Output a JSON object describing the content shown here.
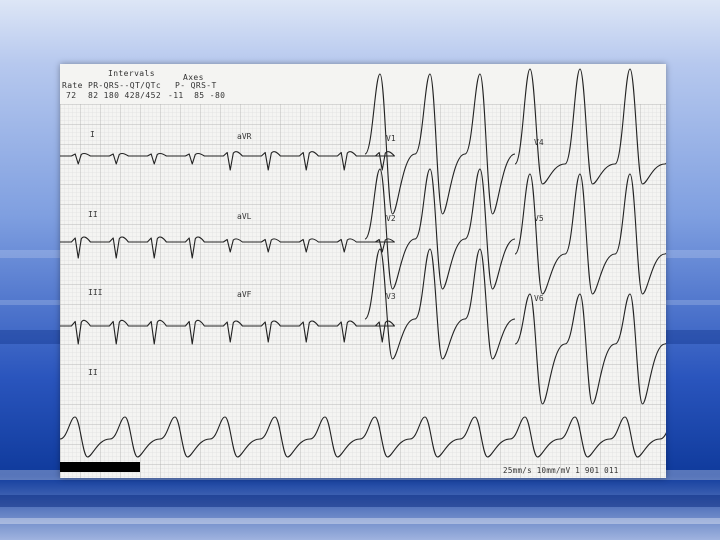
{
  "background": {
    "colors": [
      "#d9e3f5",
      "#a9bde6",
      "#3b67c8",
      "#0c2f8f",
      "#8fa5da"
    ]
  },
  "ecg": {
    "header": {
      "intervals_title": "Intervals",
      "axes_title": "Axes",
      "rate_label": "Rate",
      "intervals_cols": "PR-QRS--QT/QTc",
      "axes_cols": "P- QRS-T",
      "rate_value": "72",
      "intervals_values": "82 180 428/452",
      "axes_values": "-11  85 -80"
    },
    "leads": [
      "I",
      "II",
      "III",
      "II",
      "aVR",
      "aVL",
      "aVF",
      "V1",
      "V2",
      "V3",
      "V4",
      "V5",
      "V6"
    ],
    "footer": "25mm/s 10mm/mV 1 901 011"
  }
}
